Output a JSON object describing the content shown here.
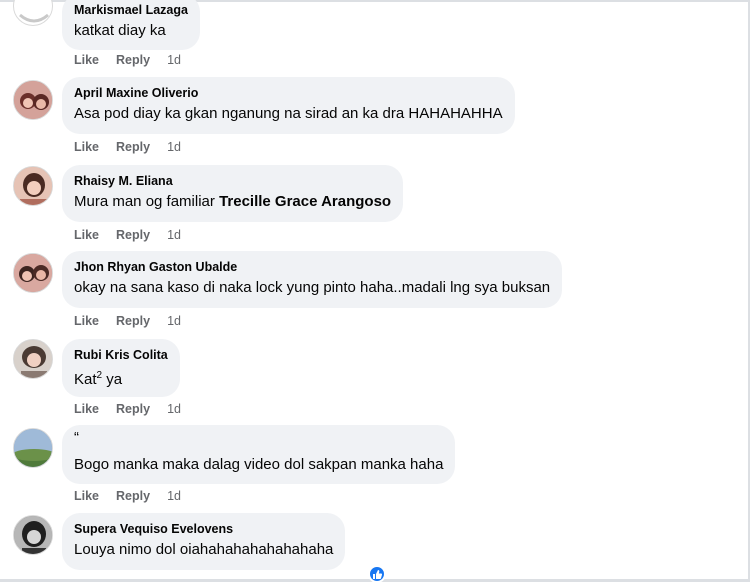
{
  "actions": {
    "like": "Like",
    "reply": "Reply"
  },
  "comments": [
    {
      "author": "Markismael Lazaga",
      "text": "katkat diay ka",
      "time": "1d"
    },
    {
      "author": "April Maxine Oliverio",
      "text": "Asa pod diay ka gkan nganung na sirad an ka dra HAHAHAHHA",
      "time": "1d"
    },
    {
      "author": "Rhaisy M. Eliana",
      "text": "Mura man og familiar",
      "mention": "Trecille Grace Arangoso",
      "time": "1d"
    },
    {
      "author": "Jhon Rhyan Gaston Ubalde",
      "text": "okay na sana kaso di naka lock yung pinto haha..madali lng sya buksan",
      "time": "1d"
    },
    {
      "author": "Rubi Kris Colita",
      "text": "Kat",
      "superscript": "2",
      "text_after": " ya",
      "time": "1d"
    },
    {
      "author": "“",
      "text": "Bogo manka maka dalag video dol sakpan manka haha",
      "time": "1d"
    },
    {
      "author": "Supera Vequiso Evelovens",
      "text": "Louya nimo dol oiahahahahahahahaha"
    }
  ]
}
